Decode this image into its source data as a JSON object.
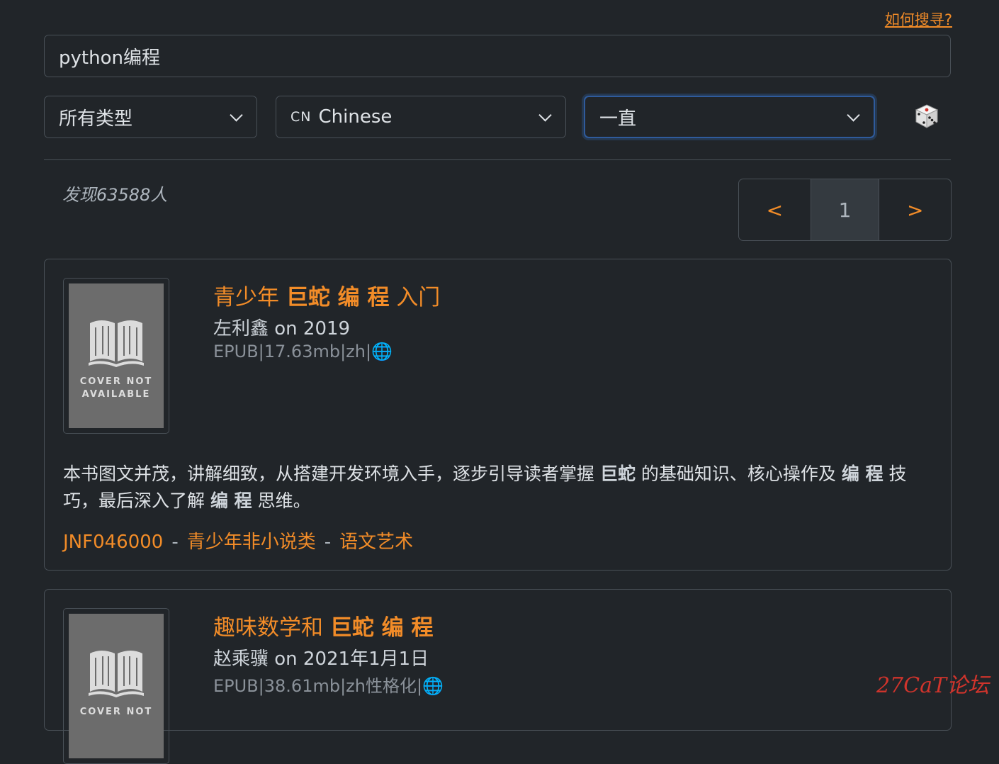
{
  "help_link": "如何搜寻?",
  "search": {
    "value": "python编程"
  },
  "filters": {
    "type": "所有类型",
    "language_flag": "CN",
    "language": "Chinese",
    "time": "一直"
  },
  "results": {
    "found": "发现63588人"
  },
  "pager": {
    "prev": "<",
    "current": "1",
    "next": ">"
  },
  "books": [
    {
      "cover_text_1": "COVER NOT",
      "cover_text_2": "AVAILABLE",
      "title_1": "青少年 ",
      "title_2": "巨蛇 编 程",
      "title_3": " 入门",
      "author": "左利鑫 on 2019",
      "meta": "EPUB|17.63mb|zh|",
      "desc_1": "本书图文并茂，讲解细致，从搭建开发环境入手，逐步引导读者掌握 ",
      "desc_2": "巨蛇",
      "desc_3": " 的基础知识、核心操作及 ",
      "desc_4": "编 程",
      "desc_5": " 技巧，最后深入了解 ",
      "desc_6": "编 程",
      "desc_7": " 思维。",
      "tag_1": "JNF046000",
      "tag_2": "青少年非小说类",
      "tag_3": "语文艺术",
      "tag_sep": "-"
    },
    {
      "cover_text_1": "COVER NOT",
      "title_1": "趣味数学和 ",
      "title_2": "巨蛇 编 程",
      "author": "赵乘骥 on 2021年1月1日",
      "meta": "EPUB|38.61mb|zh性格化|"
    }
  ],
  "watermark": "27CaT论坛"
}
